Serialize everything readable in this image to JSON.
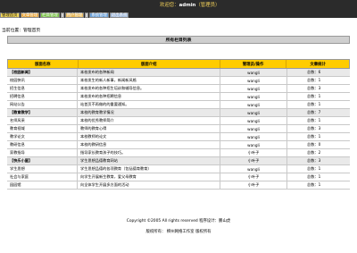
{
  "header": {
    "welcome_prefix": "欢迎您：",
    "username": "admin",
    "role": "（管理员）"
  },
  "tabs": [
    {
      "label": "管理首页",
      "bg": "#f2d75c",
      "fg": "#000000"
    },
    {
      "label": "文章管理",
      "bg": "#e8a63c",
      "fg": "#ffffff"
    },
    {
      "label": "栏目管理",
      "bg": "#7cc24b",
      "fg": "#ffffff"
    },
    {
      "label": "",
      "bg": "#d1d1d1",
      "fg": "#000000"
    },
    {
      "label": "用户管理",
      "bg": "#e6b85a",
      "fg": "#ffffff"
    },
    {
      "label": "",
      "bg": "#d1d1d1",
      "fg": "#000000"
    },
    {
      "label": "系统管理",
      "bg": "#6aa0d8",
      "fg": "#ffffff"
    },
    {
      "label": "退出系统",
      "bg": "#9cb6d8",
      "fg": "#ffffff"
    }
  ],
  "location": "当前位置：管理首页",
  "table": {
    "title": "所有栏目列表",
    "columns": [
      "版面名称",
      "版面介绍",
      "管理员/操作",
      "文章统计"
    ],
    "rows": [
      {
        "type": "category",
        "name": "【校园新闻】",
        "desc": "本校发布的各种新闻",
        "admin": "wangli",
        "count": "总数：6"
      },
      {
        "type": "item",
        "name": "校园快讯",
        "desc": "本校发生的新人新事，新闻新风格",
        "admin": "wangli",
        "count": "总数：1"
      },
      {
        "type": "item",
        "name": "招生信息",
        "desc": "本校发布的各种招生培训和辅导信息。",
        "admin": "wangli",
        "count": "总数：3"
      },
      {
        "type": "item",
        "name": "招聘信息",
        "desc": "本校发布的各种招聘信息",
        "admin": "wangli",
        "count": "总数：1"
      },
      {
        "type": "item",
        "name": "网站公告",
        "desc": "站首页不再做的的重要通知。",
        "admin": "wangli",
        "count": "总数：1"
      },
      {
        "type": "category",
        "name": "【教育教学】",
        "desc": "本校的教育教学情况",
        "admin": "wangli",
        "count": "总数：7"
      },
      {
        "type": "item",
        "name": "名师风采",
        "desc": "本校的优秀教师简介",
        "admin": "wangli",
        "count": "总数：1"
      },
      {
        "type": "item",
        "name": "教育视域",
        "desc": "教师的教育心得",
        "admin": "wangli",
        "count": "总数：3"
      },
      {
        "type": "item",
        "name": "教学论文",
        "desc": "本校教师的论文",
        "admin": "wangli",
        "count": "总数：1"
      },
      {
        "type": "item",
        "name": "教研信息",
        "desc": "本校的教研信息",
        "admin": "wangli",
        "count": "总数：0"
      },
      {
        "type": "item",
        "name": "家教指导",
        "desc": "指导家长教育孩子的技巧。",
        "admin": "小叶子",
        "count": "总数：2"
      },
      {
        "type": "category",
        "name": "【快乐小屋】",
        "desc": "学生思想品德教育网站",
        "admin": "小叶子",
        "count": "总数：3"
      },
      {
        "type": "item",
        "name": "学生思想",
        "desc": "学生思想品德的各项教育（包括德育教育）",
        "admin": "wangli",
        "count": "总数：1"
      },
      {
        "type": "item",
        "name": "社会与家庭",
        "desc": "向学生开展新生教育，爱父母教育",
        "admin": "小叶子",
        "count": "总数：1"
      },
      {
        "type": "item",
        "name": "园园馆",
        "desc": "向全体学生开展多方面的活动",
        "admin": "小叶子",
        "count": "总数：1"
      }
    ]
  },
  "footer": {
    "copyright": "Copyright ©2005 All rights reserved 程序设计：鹏山虎",
    "rights": "版权所有：  柳州网络工作室  版权所有"
  }
}
